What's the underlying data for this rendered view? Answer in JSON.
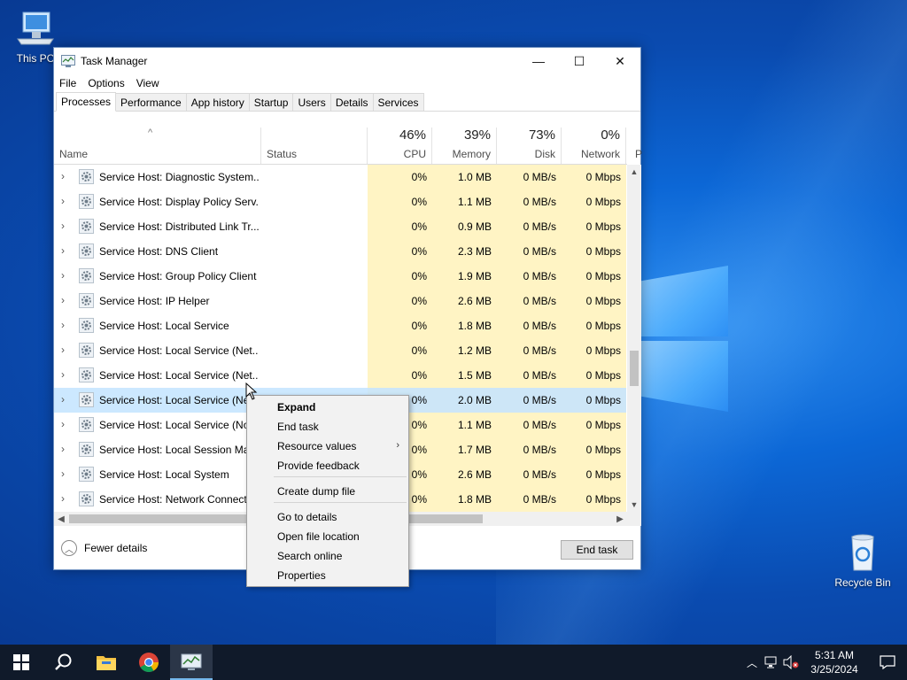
{
  "desktop": {
    "icons": [
      {
        "label": "This PC"
      },
      {
        "label": "Recycle Bin"
      }
    ]
  },
  "window": {
    "title": "Task Manager",
    "controls": {
      "minimize": "—",
      "maximize": "☐",
      "close": "✕"
    },
    "menu": [
      "File",
      "Options",
      "View"
    ],
    "tabs": [
      "Processes",
      "Performance",
      "App history",
      "Startup",
      "Users",
      "Details",
      "Services"
    ],
    "active_tab": "Processes",
    "columns": {
      "name": "Name",
      "status": "Status",
      "cpu": {
        "label": "CPU",
        "pct": "46%"
      },
      "memory": {
        "label": "Memory",
        "pct": "39%"
      },
      "disk": {
        "label": "Disk",
        "pct": "73%"
      },
      "network": {
        "label": "Network",
        "pct": "0%"
      },
      "power_partial": "P"
    },
    "processes": [
      {
        "name": "Service Host: Diagnostic System...",
        "cpu": "0%",
        "memory": "1.0 MB",
        "disk": "0 MB/s",
        "network": "0 Mbps"
      },
      {
        "name": "Service Host: Display Policy Serv...",
        "cpu": "0%",
        "memory": "1.1 MB",
        "disk": "0 MB/s",
        "network": "0 Mbps"
      },
      {
        "name": "Service Host: Distributed Link Tr...",
        "cpu": "0%",
        "memory": "0.9 MB",
        "disk": "0 MB/s",
        "network": "0 Mbps"
      },
      {
        "name": "Service Host: DNS Client",
        "cpu": "0%",
        "memory": "2.3 MB",
        "disk": "0 MB/s",
        "network": "0 Mbps"
      },
      {
        "name": "Service Host: Group Policy Client",
        "cpu": "0%",
        "memory": "1.9 MB",
        "disk": "0 MB/s",
        "network": "0 Mbps"
      },
      {
        "name": "Service Host: IP Helper",
        "cpu": "0%",
        "memory": "2.6 MB",
        "disk": "0 MB/s",
        "network": "0 Mbps"
      },
      {
        "name": "Service Host: Local Service",
        "cpu": "0%",
        "memory": "1.8 MB",
        "disk": "0 MB/s",
        "network": "0 Mbps"
      },
      {
        "name": "Service Host: Local Service (Net...",
        "cpu": "0%",
        "memory": "1.2 MB",
        "disk": "0 MB/s",
        "network": "0 Mbps"
      },
      {
        "name": "Service Host: Local Service (Net...",
        "cpu": "0%",
        "memory": "1.5 MB",
        "disk": "0 MB/s",
        "network": "0 Mbps"
      },
      {
        "name": "Service Host: Local Service (Net...",
        "cpu": "0%",
        "memory": "2.0 MB",
        "disk": "0 MB/s",
        "network": "0 Mbps"
      },
      {
        "name": "Service Host: Local Service (No ...",
        "cpu": "0%",
        "memory": "1.1 MB",
        "disk": "0 MB/s",
        "network": "0 Mbps"
      },
      {
        "name": "Service Host: Local Session Man...",
        "cpu": "0%",
        "memory": "1.7 MB",
        "disk": "0 MB/s",
        "network": "0 Mbps"
      },
      {
        "name": "Service Host: Local System",
        "cpu": "0%",
        "memory": "2.6 MB",
        "disk": "0 MB/s",
        "network": "0 Mbps"
      },
      {
        "name": "Service Host: Network Connecti...",
        "cpu": "0%",
        "memory": "1.8 MB",
        "disk": "0 MB/s",
        "network": "0 Mbps"
      }
    ],
    "selected_row": 9,
    "footer": {
      "fewer_details": "Fewer details",
      "end_task": "End task"
    }
  },
  "context_menu": {
    "items": [
      {
        "label": "Expand",
        "bold": true
      },
      {
        "label": "End task"
      },
      {
        "label": "Resource values",
        "submenu": true
      },
      {
        "label": "Provide feedback"
      },
      {
        "label": "Create dump file"
      },
      {
        "label": "Go to details"
      },
      {
        "label": "Open file location"
      },
      {
        "label": "Search online"
      },
      {
        "label": "Properties"
      }
    ]
  },
  "taskbar": {
    "clock_time": "5:31 AM",
    "clock_date": "3/25/2024",
    "apps": [
      "start",
      "search",
      "file-explorer",
      "chrome",
      "task-manager"
    ]
  }
}
